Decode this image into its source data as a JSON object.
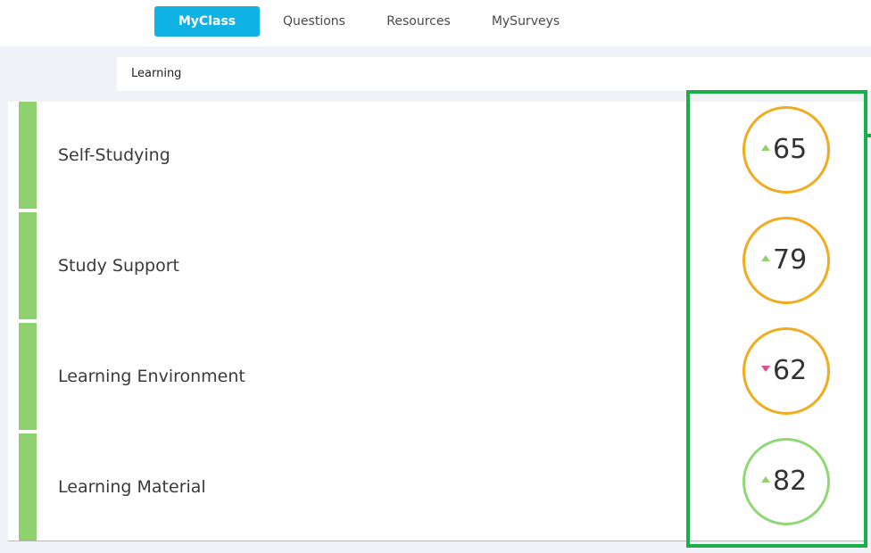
{
  "nav": {
    "items": [
      {
        "label": "MyClass",
        "active": true
      },
      {
        "label": "Questions",
        "active": false
      },
      {
        "label": "Resources",
        "active": false
      },
      {
        "label": "MySurveys",
        "active": false
      }
    ]
  },
  "breadcrumb": {
    "label": "Learning"
  },
  "categories": [
    {
      "label": "Self-Studying",
      "score": "65",
      "trend": "up",
      "ring": "orange"
    },
    {
      "label": "Study Support",
      "score": "79",
      "trend": "up",
      "ring": "orange"
    },
    {
      "label": "Learning Environment",
      "score": "62",
      "trend": "down",
      "ring": "orange"
    },
    {
      "label": "Learning Material",
      "score": "82",
      "trend": "up",
      "ring": "green"
    }
  ],
  "colors": {
    "accent": "#10b2e4",
    "row_bar": "#8fd16f",
    "ring_orange": "#f0ac1e",
    "ring_green": "#90d874",
    "trend_up": "#8fd16f",
    "trend_down": "#e44c8e",
    "highlight": "#1aae4a"
  }
}
